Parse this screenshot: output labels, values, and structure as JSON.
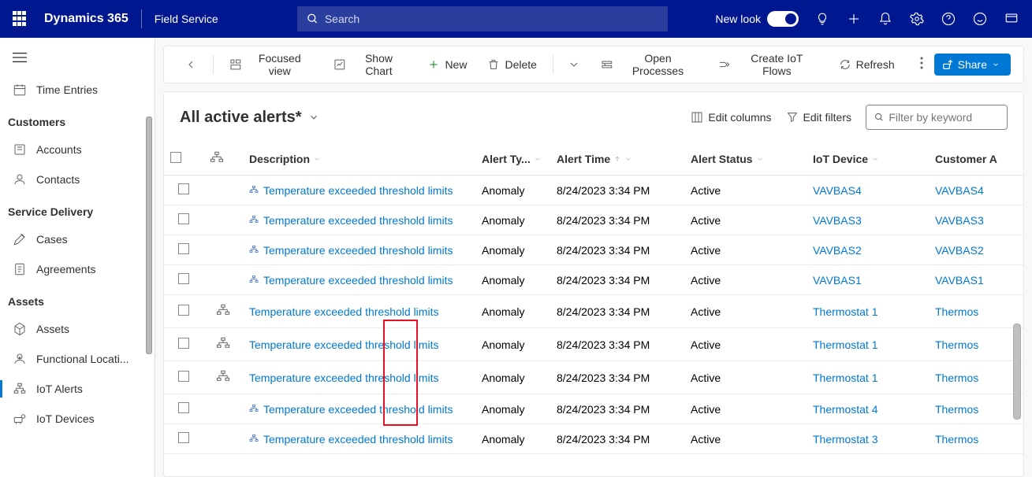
{
  "header": {
    "title": "Dynamics 365",
    "subtitle": "Field Service",
    "search_placeholder": "Search",
    "newlook_label": "New look"
  },
  "sidebar": {
    "timeentries": "Time Entries",
    "group_customers": "Customers",
    "accounts": "Accounts",
    "contacts": "Contacts",
    "group_service": "Service Delivery",
    "cases": "Cases",
    "agreements": "Agreements",
    "group_assets": "Assets",
    "assets": "Assets",
    "locations": "Functional Locati...",
    "iotalerts": "IoT Alerts",
    "iotdevices": "IoT Devices"
  },
  "toolbar": {
    "focused": "Focused view",
    "chart": "Show Chart",
    "new": "New",
    "delete": "Delete",
    "processes": "Open Processes",
    "flows": "Create IoT Flows",
    "refresh": "Refresh",
    "share": "Share"
  },
  "view": {
    "title": "All active alerts*",
    "editcols": "Edit columns",
    "editfilters": "Edit filters",
    "filter_placeholder": "Filter by keyword"
  },
  "columns": {
    "description": "Description",
    "alerttype": "Alert Ty...",
    "alerttime": "Alert Time",
    "alertstatus": "Alert Status",
    "iotdevice": "IoT Device",
    "customer": "Customer A"
  },
  "rows": [
    {
      "desc": "Temperature exceeded threshold limits",
      "type": "Anomaly",
      "time": "8/24/2023 3:34 PM",
      "status": "Active",
      "device": "VAVBAS4",
      "customer": "VAVBAS4",
      "hier": false,
      "small": true
    },
    {
      "desc": "Temperature exceeded threshold limits",
      "type": "Anomaly",
      "time": "8/24/2023 3:34 PM",
      "status": "Active",
      "device": "VAVBAS3",
      "customer": "VAVBAS3",
      "hier": false,
      "small": true
    },
    {
      "desc": "Temperature exceeded threshold limits",
      "type": "Anomaly",
      "time": "8/24/2023 3:34 PM",
      "status": "Active",
      "device": "VAVBAS2",
      "customer": "VAVBAS2",
      "hier": false,
      "small": true
    },
    {
      "desc": "Temperature exceeded threshold limits",
      "type": "Anomaly",
      "time": "8/24/2023 3:34 PM",
      "status": "Active",
      "device": "VAVBAS1",
      "customer": "VAVBAS1",
      "hier": false,
      "small": true
    },
    {
      "desc": "Temperature exceeded threshold limits",
      "type": "Anomaly",
      "time": "8/24/2023 3:34 PM",
      "status": "Active",
      "device": "Thermostat 1",
      "customer": "Thermos",
      "hier": true,
      "small": false
    },
    {
      "desc": "Temperature exceeded threshold limits",
      "type": "Anomaly",
      "time": "8/24/2023 3:34 PM",
      "status": "Active",
      "device": "Thermostat 1",
      "customer": "Thermos",
      "hier": true,
      "small": false
    },
    {
      "desc": "Temperature exceeded threshold limits",
      "type": "Anomaly",
      "time": "8/24/2023 3:34 PM",
      "status": "Active",
      "device": "Thermostat 1",
      "customer": "Thermos",
      "hier": true,
      "small": false
    },
    {
      "desc": "Temperature exceeded threshold limits",
      "type": "Anomaly",
      "time": "8/24/2023 3:34 PM",
      "status": "Active",
      "device": "Thermostat 4",
      "customer": "Thermos",
      "hier": false,
      "small": true
    },
    {
      "desc": "Temperature exceeded threshold limits",
      "type": "Anomaly",
      "time": "8/24/2023 3:34 PM",
      "status": "Active",
      "device": "Thermostat 3",
      "customer": "Thermos",
      "hier": false,
      "small": true
    }
  ]
}
